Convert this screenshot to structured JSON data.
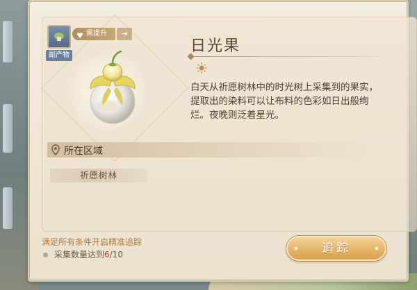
{
  "item": {
    "name": "日光果",
    "badge_label": "副产物",
    "upgrade_label": "需提升",
    "upgrade_arrow": "⇥",
    "description": "白天从祈愿树林中的时光树上采集到的果实，提取出的染料可以让布料的色彩如日出般绚烂。夜晚则泛着星光。",
    "icon": "sun-fruit"
  },
  "region": {
    "title": "所在区域",
    "items": [
      "祈愿树林"
    ]
  },
  "condition": {
    "title": "满足所有条件开启精准追踪",
    "text_prefix": "采集数量达到",
    "progress": "6",
    "progress_total": "/10"
  },
  "actions": {
    "track_label": "追踪"
  },
  "colors": {
    "accent": "#e5b567",
    "progress_highlight": "#c0402e",
    "condition_title": "#b07b3f"
  }
}
